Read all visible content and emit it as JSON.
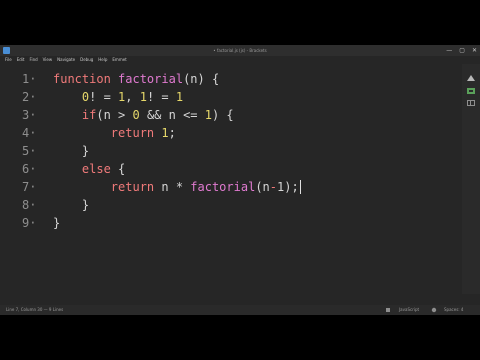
{
  "window": {
    "title": "• factorial.js (js) - Brackets",
    "controls": {
      "minimize": "—",
      "maximize": "▢",
      "close": "✕"
    }
  },
  "menu": {
    "items": [
      "File",
      "Edit",
      "Find",
      "View",
      "Navigate",
      "Debug",
      "Help",
      "Emmet"
    ]
  },
  "editor": {
    "lines": [
      {
        "number": "1",
        "tokens": [
          {
            "t": "function",
            "c": "kw"
          },
          {
            "t": " "
          },
          {
            "t": "factorial",
            "c": "fn"
          },
          {
            "t": "(n) {"
          }
        ]
      },
      {
        "number": "2",
        "tokens": [
          {
            "t": "    "
          },
          {
            "t": "0",
            "c": "num"
          },
          {
            "t": "! = "
          },
          {
            "t": "1",
            "c": "num"
          },
          {
            "t": ", "
          },
          {
            "t": "1",
            "c": "num"
          },
          {
            "t": "! = "
          },
          {
            "t": "1",
            "c": "num"
          }
        ]
      },
      {
        "number": "3",
        "tokens": [
          {
            "t": "    "
          },
          {
            "t": "if",
            "c": "kw"
          },
          {
            "t": "(n > "
          },
          {
            "t": "0",
            "c": "num"
          },
          {
            "t": " && n <= "
          },
          {
            "t": "1",
            "c": "num"
          },
          {
            "t": ") {"
          }
        ]
      },
      {
        "number": "4",
        "tokens": [
          {
            "t": "        "
          },
          {
            "t": "return",
            "c": "kw"
          },
          {
            "t": " "
          },
          {
            "t": "1",
            "c": "num"
          },
          {
            "t": ";"
          }
        ]
      },
      {
        "number": "5",
        "tokens": [
          {
            "t": "    }"
          }
        ]
      },
      {
        "number": "6",
        "tokens": [
          {
            "t": "    "
          },
          {
            "t": "else",
            "c": "kw"
          },
          {
            "t": " {"
          }
        ]
      },
      {
        "number": "7",
        "tokens": [
          {
            "t": "        "
          },
          {
            "t": "return",
            "c": "kw"
          },
          {
            "t": " n * "
          },
          {
            "t": "factorial",
            "c": "fn"
          },
          {
            "t": "(n"
          },
          {
            "t": "-",
            "c": "kw"
          },
          {
            "t": "1);"
          }
        ]
      },
      {
        "number": "8",
        "tokens": [
          {
            "t": "    }"
          }
        ]
      },
      {
        "number": "9",
        "tokens": [
          {
            "t": "}"
          }
        ]
      }
    ]
  },
  "status": {
    "position": "Line 7, Column 30 — 9 Lines",
    "language": "JavaScript",
    "indent": "Spaces: 4"
  },
  "icons": {
    "app": "brackets-app-icon",
    "side": [
      "live-preview-icon",
      "extract-icon",
      "extension-manager-icon"
    ]
  },
  "colors": {
    "keyword": "#f07a7a",
    "function": "#e07ad0",
    "number": "#e6d86a",
    "text": "#d6d6d6",
    "line_number": "#8e8e8e",
    "background": "#262626"
  }
}
